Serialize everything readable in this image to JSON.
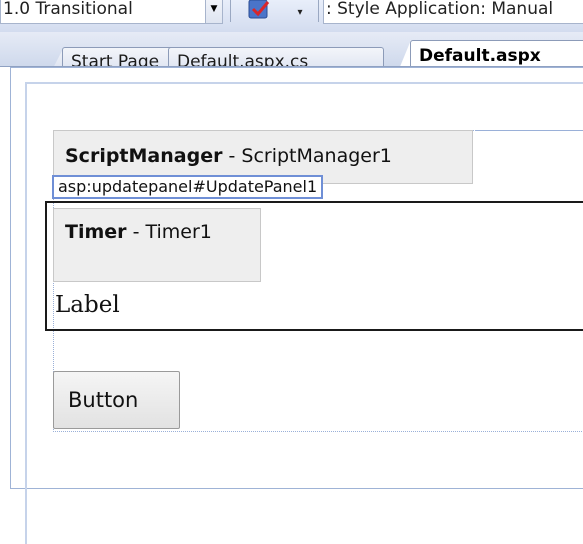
{
  "toolbar": {
    "doctype_combo": "1.0 Transitional",
    "style_application_combo": ": Style Application:  Manual"
  },
  "tabs": [
    {
      "label": "Start Page",
      "active": false
    },
    {
      "label": "Default.aspx.cs",
      "active": false
    },
    {
      "label": "Default.aspx",
      "active": true
    }
  ],
  "designer": {
    "script_manager": {
      "type": "ScriptManager",
      "id": " - ScriptManager1"
    },
    "update_panel_tag": "asp:updatepanel#UpdatePanel1",
    "timer": {
      "type": "Timer",
      "id": " - Timer1"
    },
    "label": "Label",
    "button": "Button"
  },
  "colors": {
    "selection_border": "#6f8fd6",
    "panel_border": "#1a1a1a",
    "control_bg": "#eeeeee"
  }
}
